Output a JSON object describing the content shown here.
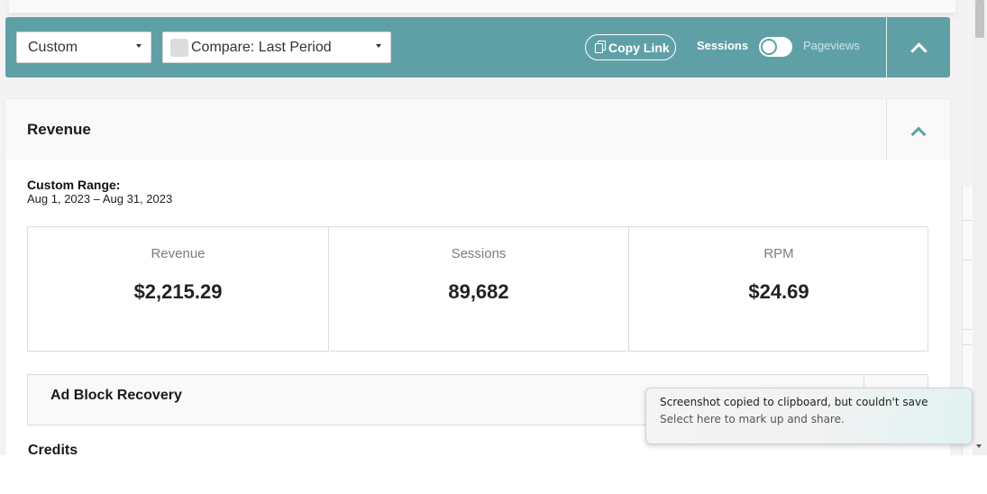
{
  "toolbar": {
    "range_select": "Custom",
    "compare_select": "Compare: Last Period",
    "copy_link": "Copy Link",
    "toggle_left_label": "Sessions",
    "toggle_right_label": "Pageviews",
    "accent_color": "#5fa0a7"
  },
  "revenue_card": {
    "title": "Revenue",
    "range_title": "Custom Range:",
    "range_dates": "Aug 1, 2023 – Aug 31, 2023",
    "stats": [
      {
        "label": "Revenue",
        "value": "$2,215.29"
      },
      {
        "label": "Sessions",
        "value": "89,682"
      },
      {
        "label": "RPM",
        "value": "$24.69"
      }
    ]
  },
  "ad_block_card": {
    "title": "Ad Block Recovery"
  },
  "credits_card": {
    "title": "Credits"
  },
  "toast": {
    "title": "Screenshot copied to clipboard, but couldn't save",
    "subtitle": "Select here to mark up and share."
  }
}
